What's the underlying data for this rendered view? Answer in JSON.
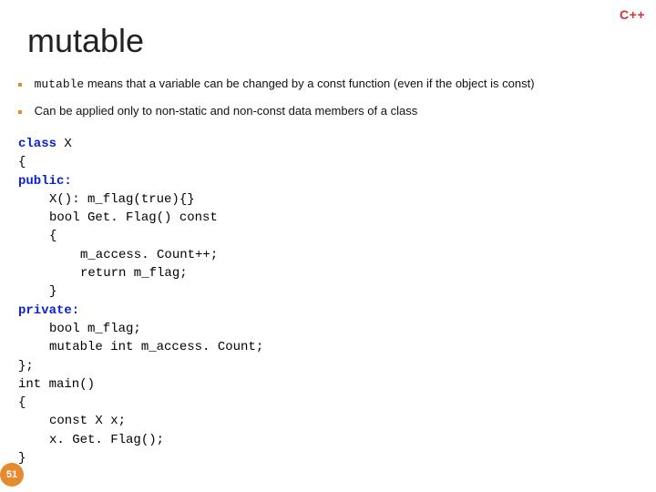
{
  "badge": "C++",
  "title": "mutable",
  "bullets": [
    {
      "keyword": "mutable",
      "rest": " means that a variable can be changed by a const function (even if the object is const)"
    },
    {
      "text": "Can be applied only to non-static and non-const data members of a class"
    }
  ],
  "code": {
    "l1_kw": "class",
    "l1_rest": " X",
    "l2": "{",
    "l3_kw": "public:",
    "l4": "X(): m_flag(true){}",
    "l5": "bool Get. Flag() const",
    "l6": "{",
    "l7": "m_access. Count++;",
    "l8": "return m_flag;",
    "l9": "}",
    "l10_kw": "private:",
    "l11": "bool m_flag;",
    "l12": "mutable int m_access. Count;",
    "l13": "};",
    "l14": "int main()",
    "l15": "{",
    "l16": "const X x;",
    "l17": "x. Get. Flag();",
    "l18": "}"
  },
  "page": "51"
}
